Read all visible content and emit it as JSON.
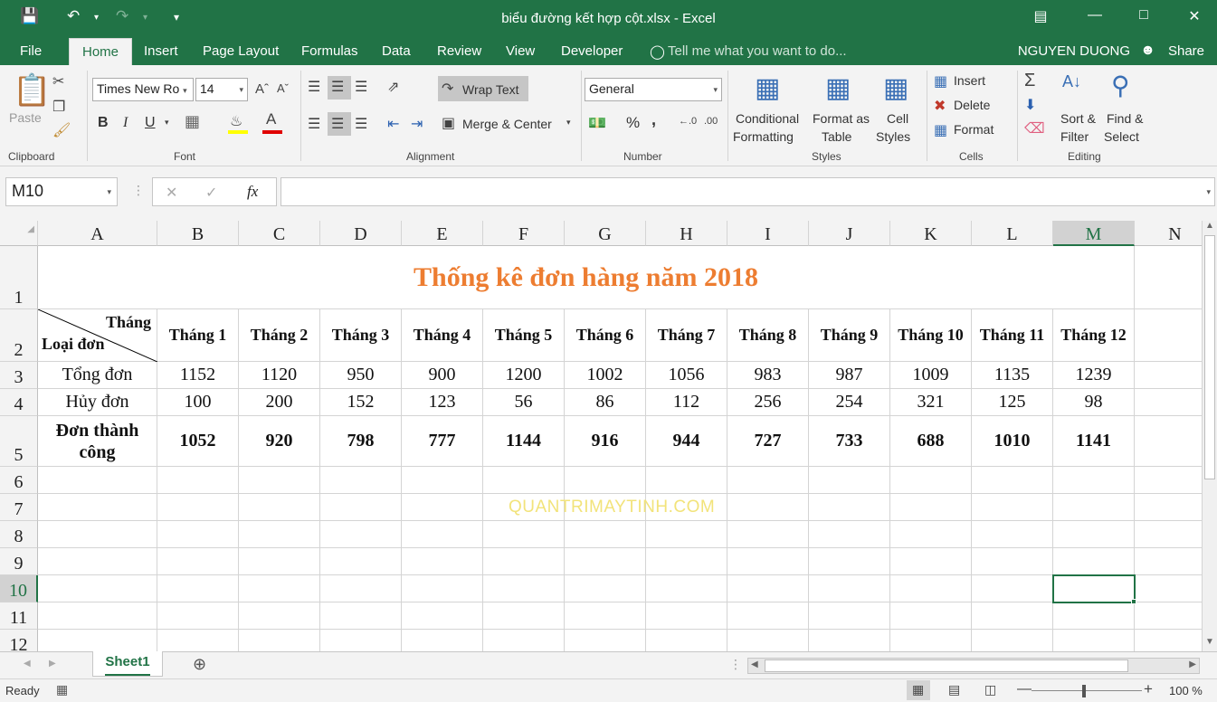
{
  "window": {
    "title": "biểu đường kết hợp cột.xlsx - Excel"
  },
  "tabs": [
    "File",
    "Home",
    "Insert",
    "Page Layout",
    "Formulas",
    "Data",
    "Review",
    "View",
    "Developer"
  ],
  "tell_me": "Tell me what you want to do...",
  "user": "NGUYEN DUONG",
  "share": "Share",
  "ribbon": {
    "clipboard": {
      "paste": "Paste",
      "label": "Clipboard"
    },
    "font": {
      "name": "Times New Ro",
      "size": "14",
      "bold": "B",
      "italic": "I",
      "underline": "U",
      "label": "Font"
    },
    "alignment": {
      "wrap": "Wrap Text",
      "merge": "Merge & Center",
      "label": "Alignment"
    },
    "number": {
      "format": "General",
      "percent": "%",
      "comma": ",",
      "label": "Number"
    },
    "styles": {
      "cond1": "Conditional",
      "cond2": "Formatting",
      "fat1": "Format as",
      "fat2": "Table",
      "cs1": "Cell",
      "cs2": "Styles",
      "label": "Styles"
    },
    "cells": {
      "insert": "Insert",
      "delete": "Delete",
      "format": "Format",
      "label": "Cells"
    },
    "editing": {
      "sort1": "Sort &",
      "sort2": "Filter",
      "find1": "Find &",
      "find2": "Select",
      "label": "Editing"
    }
  },
  "namebox": "M10",
  "fx": "fx",
  "columns": [
    "A",
    "B",
    "C",
    "D",
    "E",
    "F",
    "G",
    "H",
    "I",
    "J",
    "K",
    "L",
    "M",
    "N"
  ],
  "rows": [
    "1",
    "2",
    "3",
    "4",
    "5",
    "6",
    "7",
    "8",
    "9",
    "10",
    "11",
    "12"
  ],
  "sheet": {
    "title": "Thống kê đơn hàng năm 2018",
    "corner_top": "Tháng",
    "corner_bottom": "Loại đơn",
    "months": [
      "Tháng 1",
      "Tháng 2",
      "Tháng 3",
      "Tháng 4",
      "Tháng 5",
      "Tháng 6",
      "Tháng 7",
      "Tháng 8",
      "Tháng 9",
      "Tháng 10",
      "Tháng 11",
      "Tháng 12"
    ],
    "data_rows": [
      {
        "label": "Tổng đơn",
        "values": [
          "1152",
          "1120",
          "950",
          "900",
          "1200",
          "1002",
          "1056",
          "983",
          "987",
          "1009",
          "1135",
          "1239"
        ]
      },
      {
        "label": "Hủy đơn",
        "values": [
          "100",
          "200",
          "152",
          "123",
          "56",
          "86",
          "112",
          "256",
          "254",
          "321",
          "125",
          "98"
        ]
      },
      {
        "label_line1": "Đơn thành",
        "label_line2": "công",
        "values": [
          "1052",
          "920",
          "798",
          "777",
          "1144",
          "916",
          "944",
          "727",
          "733",
          "688",
          "1010",
          "1141"
        ]
      }
    ]
  },
  "watermark": "QUANTRIMAYTINH.COM",
  "sheet_tab": "Sheet1",
  "status": {
    "ready": "Ready",
    "zoom": "100 %"
  },
  "colors": {
    "excel_green": "#217346",
    "title_orange": "#ed7d31"
  }
}
